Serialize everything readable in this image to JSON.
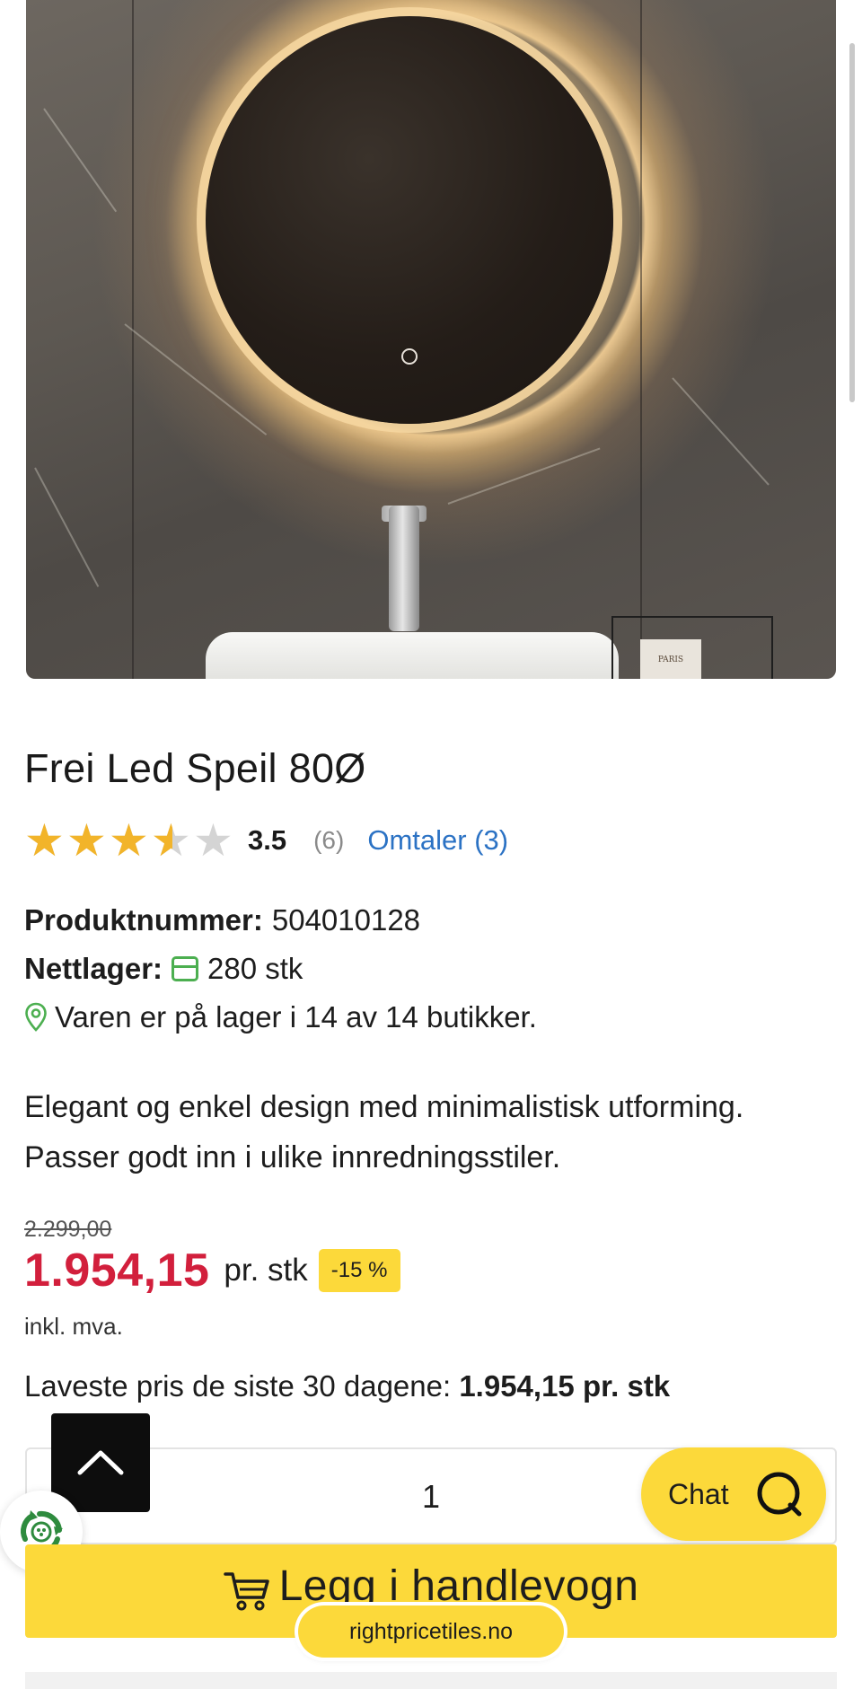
{
  "product": {
    "title": "Frei Led Speil 80Ø",
    "rating_value": "3.5",
    "rating_stars": 3.5,
    "rating_count": "(6)",
    "reviews_link": "Omtaler (3)",
    "product_number_label": "Produktnummer:",
    "product_number": "504010128",
    "online_stock_label": "Nettlager:",
    "online_stock": "280 stk",
    "store_stock": "Varen er på lager i 14 av 14 butikker.",
    "description": "Elegant og enkel design med minimalistisk utforming. Passer godt inn i ulike innredningsstiler.",
    "mirror_plate_text": "PARIS"
  },
  "price": {
    "old_price": "2.299,00",
    "current_price": "1.954,15",
    "unit": "pr. stk",
    "discount": "-15 %",
    "vat_note": "inkl. mva.",
    "lowest_label": "Laveste pris de siste 30 dagene:",
    "lowest_value": "1.954,15 pr. stk"
  },
  "cart": {
    "quantity": "1",
    "add_label": "Legg i handlevogn"
  },
  "chat": {
    "label": "Chat"
  },
  "browser": {
    "url": "rightpricetiles.no"
  },
  "colors": {
    "accent_yellow": "#fcd93a",
    "price_red": "#d21f3c",
    "link_blue": "#2b72c4",
    "star_gold": "#f2b42a",
    "stock_green": "#4caf50"
  },
  "icons": [
    "chevron-up-icon",
    "recycle-icon",
    "chat-bubble-icon",
    "cart-icon",
    "box-icon",
    "location-pin-icon",
    "star-icon"
  ]
}
